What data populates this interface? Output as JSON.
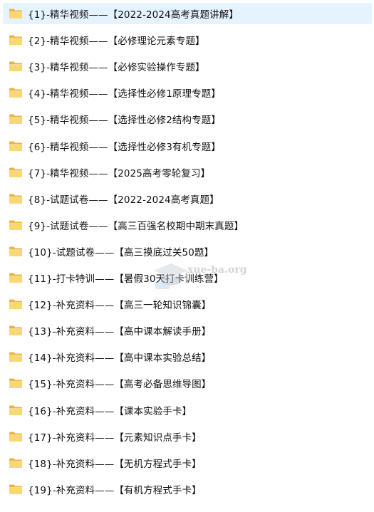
{
  "folder_list": {
    "items": [
      {
        "name": "{1}-精华视频——【2022-2024高考真题讲解】",
        "selected": true
      },
      {
        "name": "{2}-精华视频——【必修理论元素专题】"
      },
      {
        "name": "{3}-精华视频——【必修实验操作专题】"
      },
      {
        "name": "{4}-精华视频——【选择性必修1原理专题】"
      },
      {
        "name": "{5}-精华视频——【选择性必修2结构专题】"
      },
      {
        "name": "{6}-精华视频——【选择性必修3有机专题】"
      },
      {
        "name": "{7}-精华视频——【2025高考零轮复习】"
      },
      {
        "name": "{8}-试题试卷——【2022-2024高考真题】"
      },
      {
        "name": "{9}-试题试卷——【高三百强名校期中期末真题】"
      },
      {
        "name": "{10}-试题试卷——【高三摸底过关50题】"
      },
      {
        "name": "{11}-打卡特训——【暑假30天打卡训练营】"
      },
      {
        "name": "{12}-补充资料——【高三一轮知识锦囊】"
      },
      {
        "name": "{13}-补充资料——【高中课本解读手册】"
      },
      {
        "name": "{14}-补充资料——【高中课本实验总结】"
      },
      {
        "name": "{15}-补充资料——【高考必备思维导图】"
      },
      {
        "name": "{16}-补充资料——【课本实验手卡】"
      },
      {
        "name": "{17}-补充资料——【元素知识点手卡】"
      },
      {
        "name": "{18}-补充资料——【无机方程式手卡】"
      },
      {
        "name": "{19}-补充资料——【有机方程式手卡】"
      }
    ]
  },
  "watermark": {
    "text": "xue-ba.org"
  },
  "colors": {
    "folder_body": "#f8d775",
    "folder_tab": "#e8b444",
    "selection": "#e5f3ff"
  },
  "icons": {
    "folder": "folder-icon",
    "watermark_logo": "graduation-cap-icon"
  }
}
